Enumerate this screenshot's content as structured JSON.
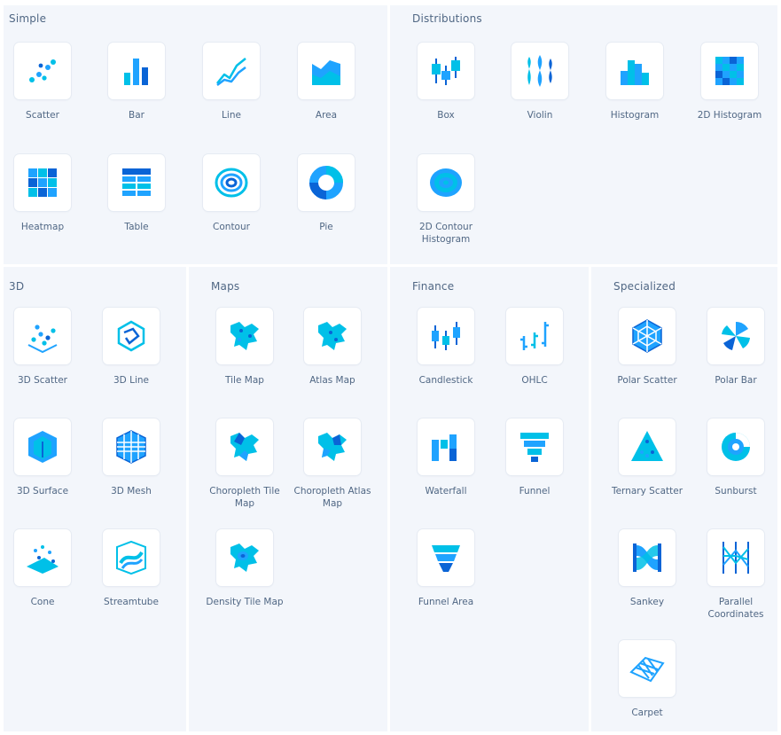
{
  "sections": {
    "simple": {
      "title": "Simple",
      "items": [
        {
          "label": "Scatter",
          "icon": "scatter-icon"
        },
        {
          "label": "Bar",
          "icon": "bar-icon"
        },
        {
          "label": "Line",
          "icon": "line-icon"
        },
        {
          "label": "Area",
          "icon": "area-icon"
        },
        {
          "label": "Heatmap",
          "icon": "heatmap-icon"
        },
        {
          "label": "Table",
          "icon": "table-icon"
        },
        {
          "label": "Contour",
          "icon": "contour-icon"
        },
        {
          "label": "Pie",
          "icon": "pie-icon"
        }
      ]
    },
    "distributions": {
      "title": "Distributions",
      "items": [
        {
          "label": "Box",
          "icon": "box-icon"
        },
        {
          "label": "Violin",
          "icon": "violin-icon"
        },
        {
          "label": "Histogram",
          "icon": "histogram-icon"
        },
        {
          "label": "2D Histogram",
          "icon": "2d-histogram-icon"
        },
        {
          "label": "2D Contour Histogram",
          "icon": "2d-contour-histogram-icon"
        }
      ]
    },
    "three_d": {
      "title": "3D",
      "items": [
        {
          "label": "3D Scatter",
          "icon": "3d-scatter-icon"
        },
        {
          "label": "3D Line",
          "icon": "3d-line-icon"
        },
        {
          "label": "3D Surface",
          "icon": "3d-surface-icon"
        },
        {
          "label": "3D Mesh",
          "icon": "3d-mesh-icon"
        },
        {
          "label": "Cone",
          "icon": "cone-icon"
        },
        {
          "label": "Streamtube",
          "icon": "streamtube-icon"
        }
      ]
    },
    "maps": {
      "title": "Maps",
      "items": [
        {
          "label": "Tile Map",
          "icon": "tile-map-icon"
        },
        {
          "label": "Atlas Map",
          "icon": "atlas-map-icon"
        },
        {
          "label": "Choropleth Tile Map",
          "icon": "choropleth-tile-map-icon"
        },
        {
          "label": "Choropleth Atlas Map",
          "icon": "choropleth-atlas-map-icon"
        },
        {
          "label": "Density Tile Map",
          "icon": "density-tile-map-icon"
        }
      ]
    },
    "finance": {
      "title": "Finance",
      "items": [
        {
          "label": "Candlestick",
          "icon": "candlestick-icon"
        },
        {
          "label": "OHLC",
          "icon": "ohlc-icon"
        },
        {
          "label": "Waterfall",
          "icon": "waterfall-icon"
        },
        {
          "label": "Funnel",
          "icon": "funnel-icon"
        },
        {
          "label": "Funnel Area",
          "icon": "funnel-area-icon"
        }
      ]
    },
    "specialized": {
      "title": "Specialized",
      "items": [
        {
          "label": "Polar Scatter",
          "icon": "polar-scatter-icon"
        },
        {
          "label": "Polar Bar",
          "icon": "polar-bar-icon"
        },
        {
          "label": "Ternary Scatter",
          "icon": "ternary-scatter-icon"
        },
        {
          "label": "Sunburst",
          "icon": "sunburst-icon"
        },
        {
          "label": "Sankey",
          "icon": "sankey-icon"
        },
        {
          "label": "Parallel Coordinates",
          "icon": "parallel-coordinates-icon"
        },
        {
          "label": "Carpet",
          "icon": "carpet-icon"
        }
      ]
    }
  },
  "colors": {
    "icon_primary": "#00c0e8",
    "icon_secondary": "#1fa3ff",
    "icon_dark": "#0a64d6",
    "panel_bg": "#f3f6fb",
    "text": "#506784"
  }
}
